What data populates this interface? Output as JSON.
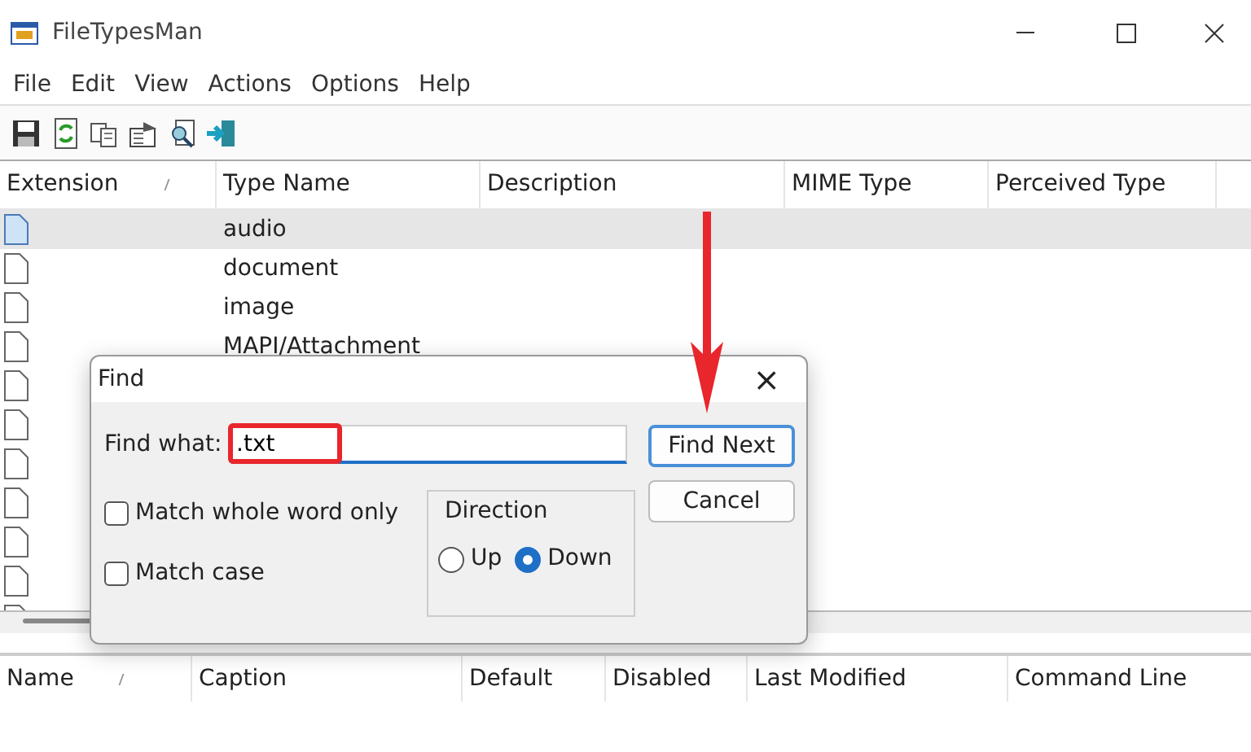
{
  "window": {
    "title": "FileTypesMan"
  },
  "menu": [
    "File",
    "Edit",
    "View",
    "Actions",
    "Options",
    "Help"
  ],
  "toolbar": [
    {
      "kind": "save"
    },
    {
      "kind": "refresh"
    },
    {
      "kind": "copy"
    },
    {
      "kind": "properties"
    },
    {
      "kind": "find"
    },
    {
      "kind": "exit"
    }
  ],
  "table": {
    "columns": [
      "Extension",
      "Type Name",
      "Description",
      "MIME Type",
      "Perceived Type"
    ],
    "rows": [
      {
        "type_name": "audio",
        "selected": true
      },
      {
        "type_name": "document",
        "selected": false
      },
      {
        "type_name": "image",
        "selected": false
      },
      {
        "type_name": "MAPI/Attachment",
        "selected": false
      },
      {
        "selected": false
      },
      {
        "selected": false
      },
      {
        "selected": false
      },
      {
        "selected": false
      },
      {
        "selected": false
      },
      {
        "selected": false
      },
      {
        "selected": false
      }
    ]
  },
  "lower_table": {
    "columns": [
      "Name",
      "Caption",
      "Default",
      "Disabled",
      "Last Modified",
      "Command Line"
    ]
  },
  "find_dialog": {
    "title": "Find",
    "close": "×",
    "find_label": "Find what:",
    "find_value": ".txt",
    "options": [
      {
        "label": "Match whole word only",
        "checked": false
      },
      {
        "label": "Match case",
        "checked": false
      }
    ],
    "direction": {
      "label": "Direction",
      "options": [
        {
          "label": "Up",
          "selected": false
        },
        {
          "label": "Down",
          "selected": true
        }
      ]
    },
    "buttons": [
      "Find Next",
      "Cancel"
    ]
  }
}
